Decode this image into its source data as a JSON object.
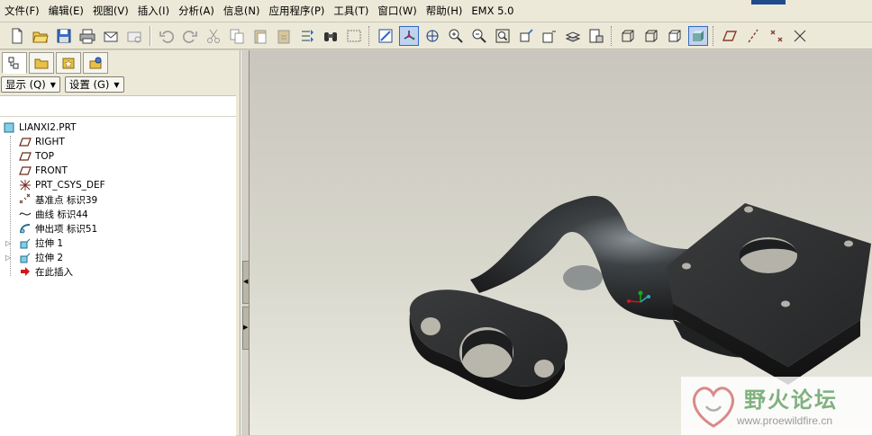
{
  "menu": [
    "文件(F)",
    "编辑(E)",
    "视图(V)",
    "插入(I)",
    "分析(A)",
    "信息(N)",
    "应用程序(P)",
    "工具(T)",
    "窗口(W)",
    "帮助(H)",
    "EMX 5.0"
  ],
  "panel": {
    "display_button": "显示 (Q)",
    "settings_button": "设置 (G)"
  },
  "tree": {
    "root": "LIANXI2.PRT",
    "items": [
      {
        "label": "RIGHT",
        "icon": "datum-plane-icon",
        "expandable": false
      },
      {
        "label": "TOP",
        "icon": "datum-plane-icon",
        "expandable": false
      },
      {
        "label": "FRONT",
        "icon": "datum-plane-icon",
        "expandable": false
      },
      {
        "label": "PRT_CSYS_DEF",
        "icon": "coordinate-system-icon",
        "expandable": false
      },
      {
        "label": "基准点 标识39",
        "icon": "datum-point-icon",
        "expandable": false
      },
      {
        "label": "曲线 标识44",
        "icon": "curve-icon",
        "expandable": false
      },
      {
        "label": "伸出项 标识51",
        "icon": "protrusion-icon",
        "expandable": false
      },
      {
        "label": "拉伸 1",
        "icon": "extrude-icon",
        "expandable": true
      },
      {
        "label": "拉伸 2",
        "icon": "extrude-icon",
        "expandable": true
      },
      {
        "label": "在此插入",
        "icon": "insert-here-arrow-icon",
        "expandable": false
      }
    ]
  },
  "watermark": {
    "title": "野火论坛",
    "url": "www.proewildfire.cn"
  },
  "colors": {
    "part_body": "#2a2a2a",
    "selection_accent": "#316ac5",
    "watermark_text": "#7fb17f"
  }
}
